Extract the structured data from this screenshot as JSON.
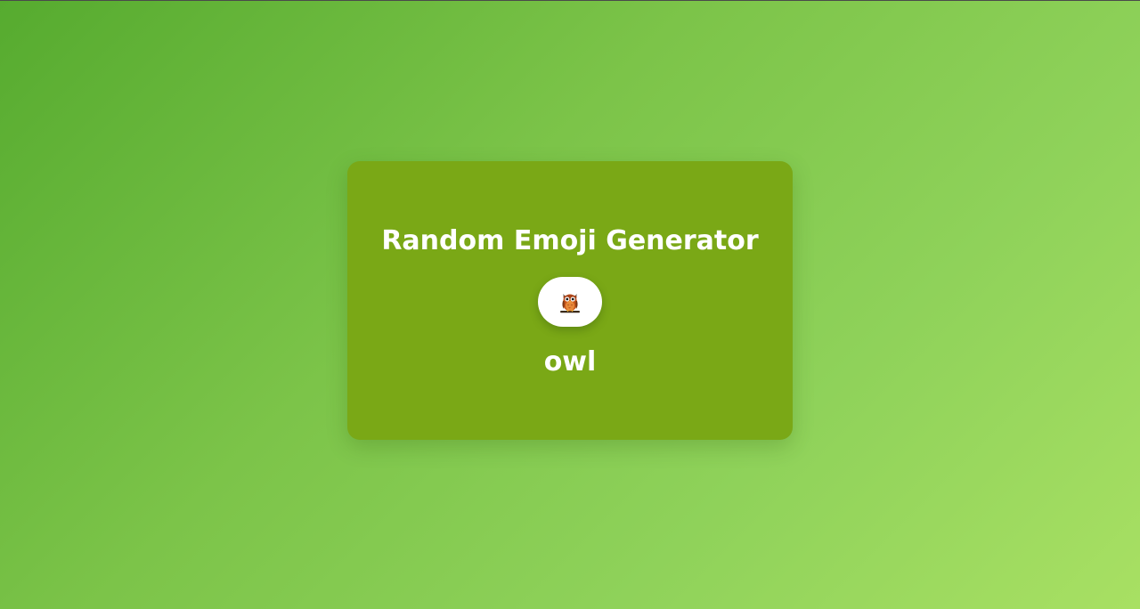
{
  "app": {
    "title": "Random Emoji Generator"
  },
  "emoji": {
    "icon": "owl-icon",
    "name": "owl"
  },
  "colors": {
    "background_start": "#56ab2f",
    "background_end": "#a8e063",
    "card": "#7aa816",
    "button": "#ffffff",
    "text": "#ffffff"
  }
}
